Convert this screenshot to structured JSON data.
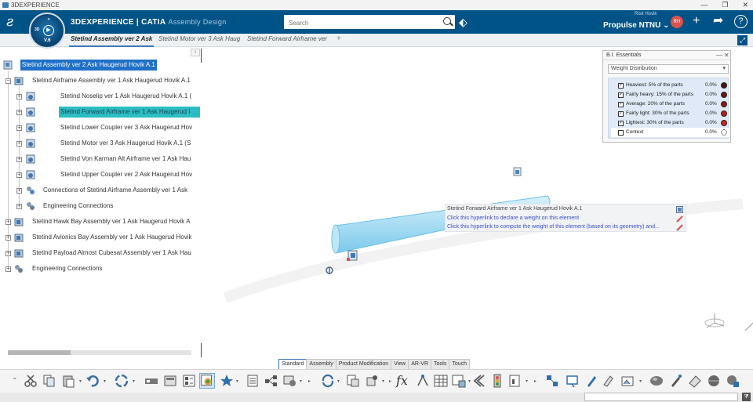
{
  "window": {
    "title": "3DEXPERIENCE"
  },
  "topbar": {
    "brand_main": "3DEXPERIENCE | CATIA",
    "brand_sub": "Assembly Design",
    "compass_version": "V.6",
    "compass_left": "3D",
    "search_placeholder": "Search",
    "user_name": "Risk Hovik",
    "tenant": "Propulse NTNU ⌄",
    "avatar_initials": "RH",
    "accent_color": "#005386"
  },
  "tabs": [
    {
      "label": "Stetind Assembly ver 2 Ask"
    },
    {
      "label": "Stetind Motor ver 3 Ask Haug"
    },
    {
      "label": "Stetind Forward Airframe ver"
    }
  ],
  "tree": [
    {
      "label": "Stetind Assembly ver 2 Ask Haugerud Hovik A.1"
    },
    {
      "label": "Stetind Airframe Assembly ver 1 Ask Haugerud Hovik A.1"
    },
    {
      "label": "Stetind Noselip ver 1 Ask Haugerud Hovik A.1 ("
    },
    {
      "label": "Stetind Forward Airframe ver 1 Ask Haugerud I"
    },
    {
      "label": "Stetind Lower Coupler ver 3 Ask Haugerud Hov"
    },
    {
      "label": "Stetind Motor ver 3 Ask Haugerud Hovik A.1 (S"
    },
    {
      "label": "Stetind Von Karman Alt Airframe ver 1 Ask Hau"
    },
    {
      "label": "Stetind Upper Coupler ver 2 Ask Haugerud Hov"
    },
    {
      "label": "Connections of Stetind Airframe Assembly ver 1 Ask"
    },
    {
      "label": "Engineering Connections"
    },
    {
      "label": "Stetind Hawk Bay Assembly ver 1 Ask Haugerud Hovik A"
    },
    {
      "label": "Stetind Avionics Bay Assembly ver 1 Ask Haugerud Hovik"
    },
    {
      "label": "Stetind Payload Almost Cubesat Assembly ver 1 Ask Hau"
    },
    {
      "label": "Engineering Connections"
    }
  ],
  "bi_essentials": {
    "title": "B.I. Essentials",
    "dropdown": "Weight Distribution",
    "rows": [
      {
        "label": "Heaviest: 5% of the parts",
        "value": "0.0%",
        "checked": true,
        "color": "#4a1212"
      },
      {
        "label": "Fairly heavy: 15% of the parts",
        "value": "0.0%",
        "checked": true,
        "color": "#6b1515"
      },
      {
        "label": "Average: 20% of the parts",
        "value": "0.0%",
        "checked": true,
        "color": "#8c1a1a"
      },
      {
        "label": "Fairly light: 30% of the parts",
        "value": "0.0%",
        "checked": true,
        "color": "#b51f1f"
      },
      {
        "label": "Lightest: 30% of the parts",
        "value": "0.0%",
        "checked": true,
        "color": "#d42424"
      },
      {
        "label": "Context",
        "value": "0.0%",
        "checked": false,
        "color": "#ffffff"
      }
    ]
  },
  "tooltip": {
    "title": "Stetind Forward Airframe ver 1 Ask Haugerud Hovik A.1",
    "link1": "Click this hyperlink to declare a weight on this element",
    "link2": "Click this hyperlink to compute the weight of this element (based on its geometry) and..."
  },
  "section_tabs": [
    "Standard",
    "Assembly",
    "Product Modification",
    "View",
    "AR-VR",
    "Tools",
    "Touch"
  ],
  "section_active": "Tools",
  "icons": {
    "window": [
      "minimize-icon",
      "maximize-icon",
      "close-icon"
    ],
    "top": [
      "tag-icon",
      "plus-icon",
      "share-icon",
      "help-icon"
    ],
    "actions": [
      "cut-icon",
      "copy-icon",
      "paste-icon",
      "undo-icon",
      "update-icon",
      "measure-icon",
      "weight-icon",
      "bom-icon",
      "bi-essentials-icon",
      "favorite-icon",
      "list-icon",
      "tree-icon",
      "settings-icon",
      "refresh-icon",
      "catalog-icon",
      "shapes-icon",
      "formula-icon",
      "knowledge-icon",
      "table-icon",
      "table-edit-icon",
      "rule-icon",
      "signal-icon",
      "parameter-icon",
      "constraint-icon",
      "move-icon",
      "publish-icon",
      "pen-icon",
      "note-icon",
      "image-icon",
      "sphere-icon",
      "brush-icon",
      "eraser-icon",
      "render-icon",
      "material-icon"
    ]
  }
}
